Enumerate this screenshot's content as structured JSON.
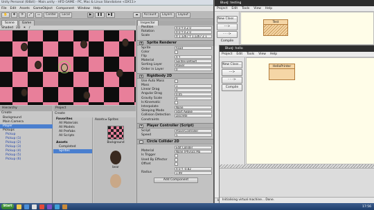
{
  "unity": {
    "title": "Unity Personal (64bit) - Main.unity - HFD GAME - PC, Mac & Linux Standalone <DX11>",
    "menu": [
      "File",
      "Edit",
      "Assets",
      "GameObject",
      "Component",
      "Window",
      "Help"
    ],
    "toolbar": {
      "center": "Center",
      "local": "Local",
      "account": "Account",
      "layers": "Layers",
      "layout": "Layout"
    },
    "scene_tabs": [
      "Scene",
      "Game"
    ],
    "scene_bar": {
      "shaded": "Shaded",
      "mode": "2D"
    },
    "hierarchy": {
      "tab": "Hierarchy",
      "create": "Create",
      "items": [
        {
          "label": "Background",
          "blue": false
        },
        {
          "label": "Main Camera",
          "blue": false
        },
        {
          "label": "Player",
          "blue": false,
          "selected": true
        },
        {
          "label": "Pickups",
          "blue": false
        },
        {
          "label": "Pickup",
          "blue": true
        },
        {
          "label": "Pickup (1)",
          "blue": true
        },
        {
          "label": "Pickup (2)",
          "blue": true
        },
        {
          "label": "Pickup (3)",
          "blue": true
        },
        {
          "label": "Pickup (4)",
          "blue": true
        },
        {
          "label": "Pickup (5)",
          "blue": true
        },
        {
          "label": "Pickup (6)",
          "blue": true
        }
      ]
    },
    "project": {
      "tab": "Project",
      "create": "Create",
      "favorites": "Favorites",
      "fav_items": [
        "All Materials",
        "All Models",
        "All Prefabs",
        "All Scripts"
      ],
      "assets": "Assets",
      "asset_items": [
        "Completed",
        "Sprites"
      ],
      "breadcrumb": "Assets ▸ Sprites",
      "thumbs": [
        "Background",
        "bear"
      ]
    },
    "inspector": {
      "tab": "Inspector",
      "transform": [
        {
          "label": "Position",
          "val": "X 0  Y 0  Z 0"
        },
        {
          "label": "Rotation",
          "val": "X 0  Y 0  Z 0"
        },
        {
          "label": "Scale",
          "val": "X 1.1267 Y 1.1267 Z 1"
        }
      ],
      "sprite_renderer": {
        "header": "Sprite Renderer",
        "rows": [
          {
            "label": "Sprite",
            "val": "head"
          },
          {
            "label": "Color",
            "val": ""
          },
          {
            "label": "Flip",
            "val": "X  Y"
          },
          {
            "label": "Material",
            "val": "Sprites-Default"
          },
          {
            "label": "Sorting Layer",
            "val": "Player"
          },
          {
            "label": "Order in Layer",
            "val": "0"
          }
        ]
      },
      "rigidbody": {
        "header": "Rigidbody 2D",
        "rows": [
          {
            "label": "Use Auto Mass",
            "val": ""
          },
          {
            "label": "Mass",
            "val": "1"
          },
          {
            "label": "Linear Drag",
            "val": "0"
          },
          {
            "label": "Angular Drag",
            "val": "0.05"
          },
          {
            "label": "Gravity Scale",
            "val": "0"
          },
          {
            "label": "Is Kinematic",
            "val": ""
          },
          {
            "label": "Interpolate",
            "val": "None"
          },
          {
            "label": "Sleeping Mode",
            "val": "Start Awake"
          },
          {
            "label": "Collision Detection",
            "val": "Discrete"
          }
        ]
      },
      "constraints": "Constraints",
      "player_controller": {
        "header": "Player Controller (Script)",
        "rows": [
          {
            "label": "Script",
            "val": "PlayerController"
          },
          {
            "label": "Speed",
            "val": "5"
          }
        ]
      },
      "circle_collider": {
        "header": "Circle Collider 2D",
        "rows": [
          {
            "label": "",
            "val": "Edit Collider"
          },
          {
            "label": "Material",
            "val": "None (Physics Ma"
          },
          {
            "label": "Is Trigger",
            "val": ""
          },
          {
            "label": "Used By Effector",
            "val": ""
          },
          {
            "label": "Offset",
            "val": ""
          },
          {
            "label": "",
            "val": "X 0   Y -0.82"
          },
          {
            "label": "Radius",
            "val": "1.99"
          }
        ]
      },
      "add_component": "Add Component"
    }
  },
  "bluej_back": {
    "title": "BlueJ: testing",
    "menu": [
      "Project",
      "Edit",
      "Tools",
      "View",
      "Help"
    ],
    "buttons": [
      "New Class...",
      "--->",
      "- - ->",
      "Compile"
    ],
    "class_name": "Test"
  },
  "bluej_front": {
    "title": "BlueJ: hello",
    "menu": [
      "Project",
      "Edit",
      "Tools",
      "View",
      "Help"
    ],
    "buttons": [
      "New Class...",
      "--->",
      "- - ->",
      "Compile"
    ],
    "class_name": "HelloPrinter",
    "status": "Initialising virtual machine... Done."
  },
  "status_back": "Initialising virtual machine... Done.",
  "taskbar": {
    "start": "Start",
    "clock": "17:56"
  }
}
